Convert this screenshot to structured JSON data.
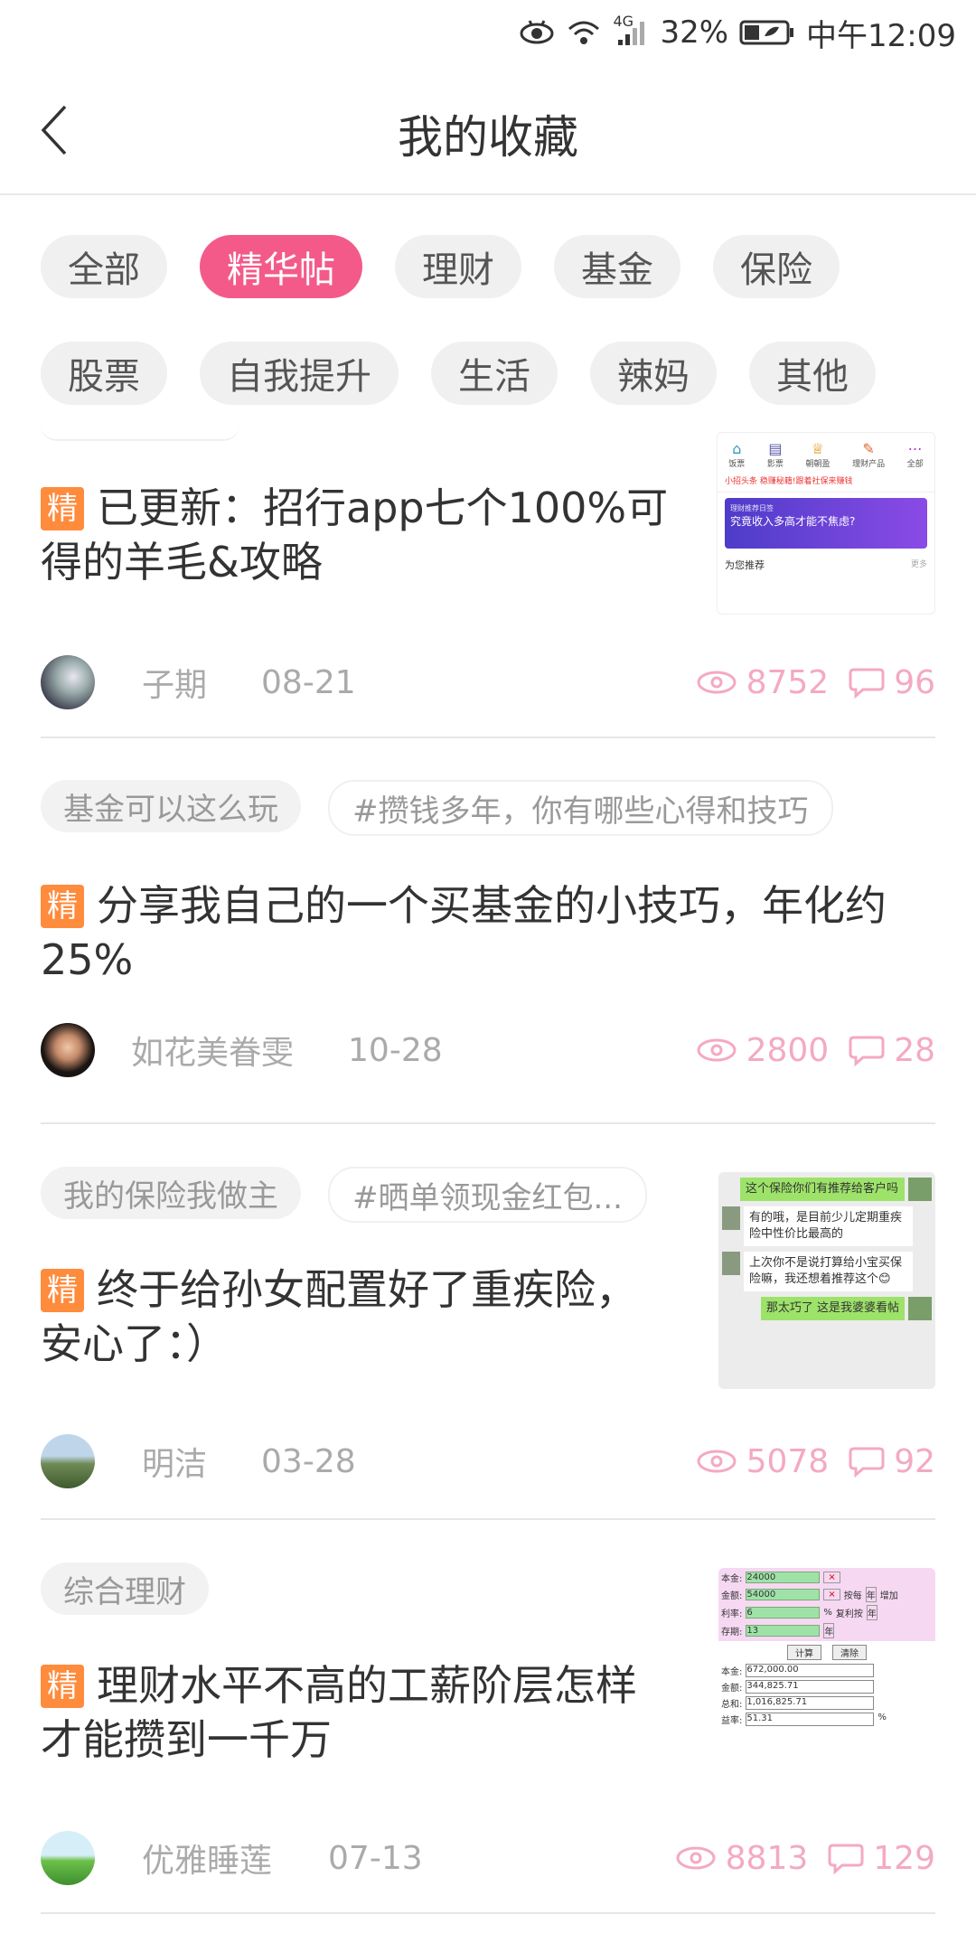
{
  "status": {
    "network": "4G",
    "battery": "32%",
    "time": "中午12:09"
  },
  "header": {
    "title": "我的收藏"
  },
  "tags": [
    "全部",
    "精华帖",
    "理财",
    "基金",
    "保险",
    "股票",
    "自我提升",
    "生活",
    "辣妈",
    "其他"
  ],
  "active_tag": "精华帖",
  "badge_label": "精",
  "posts": [
    {
      "topics": [],
      "title": "已更新：招行app七个100%可得的羊毛&攻略",
      "author": "子期",
      "date": "08-21",
      "views": "8752",
      "comments": "96",
      "thumb": {
        "tabs": [
          "饭票",
          "影票",
          "朝朝盈",
          "理财产品",
          "全部"
        ],
        "banner": "究竟收入多高才能不焦虑?",
        "subtitle": "为您推荐",
        "more": "更多",
        "news": "小招头条 稳赚秘籍!跟着社保来赚钱",
        "promo": "理财推荐日签"
      }
    },
    {
      "topics": [
        "基金可以这么玩",
        "#攒钱多年，你有哪些心得和技巧"
      ],
      "title": "分享我自己的一个买基金的小技巧，年化约25%",
      "author": "如花美眷雯",
      "date": "10-28",
      "views": "2800",
      "comments": "28"
    },
    {
      "topics": [
        "我的保险我做主",
        "#晒单领现金红包..."
      ],
      "title": "终于给孙女配置好了重疾险，安心了：）",
      "author": "明洁",
      "date": "03-28",
      "views": "5078",
      "comments": "92",
      "thumb": {
        "msgs": [
          "这个保险你们有推荐给客户吗",
          "有的哦，是目前少儿定期重疾险中性价比最高的",
          "上次你不是说打算给小宝买保险嘛，我还想着推荐这个😊",
          "那太巧了 这是我婆婆看帖"
        ]
      }
    },
    {
      "topics": [
        "综合理财"
      ],
      "title": "理财水平不高的工薪阶层怎样才能攒到一千万",
      "author": "优雅睡莲",
      "date": "07-13",
      "views": "8813",
      "comments": "129",
      "thumb": {
        "rows": [
          [
            "本金:",
            "24000"
          ],
          [
            "金额:",
            "54000"
          ],
          [
            "利率:",
            "6"
          ],
          [
            "存期:",
            "13"
          ]
        ],
        "results": [
          [
            "本金:",
            "672,000.00"
          ],
          [
            "金额:",
            "344,825.71"
          ],
          [
            "总和:",
            "1,016,825.71"
          ],
          [
            "益率:",
            "51.31"
          ]
        ],
        "calc": "计算",
        "clear": "清除",
        "unit": "年",
        "pct": "%",
        "per": "按每",
        "per2": "复利按",
        "inc": "增加",
        "x": "×"
      }
    }
  ]
}
